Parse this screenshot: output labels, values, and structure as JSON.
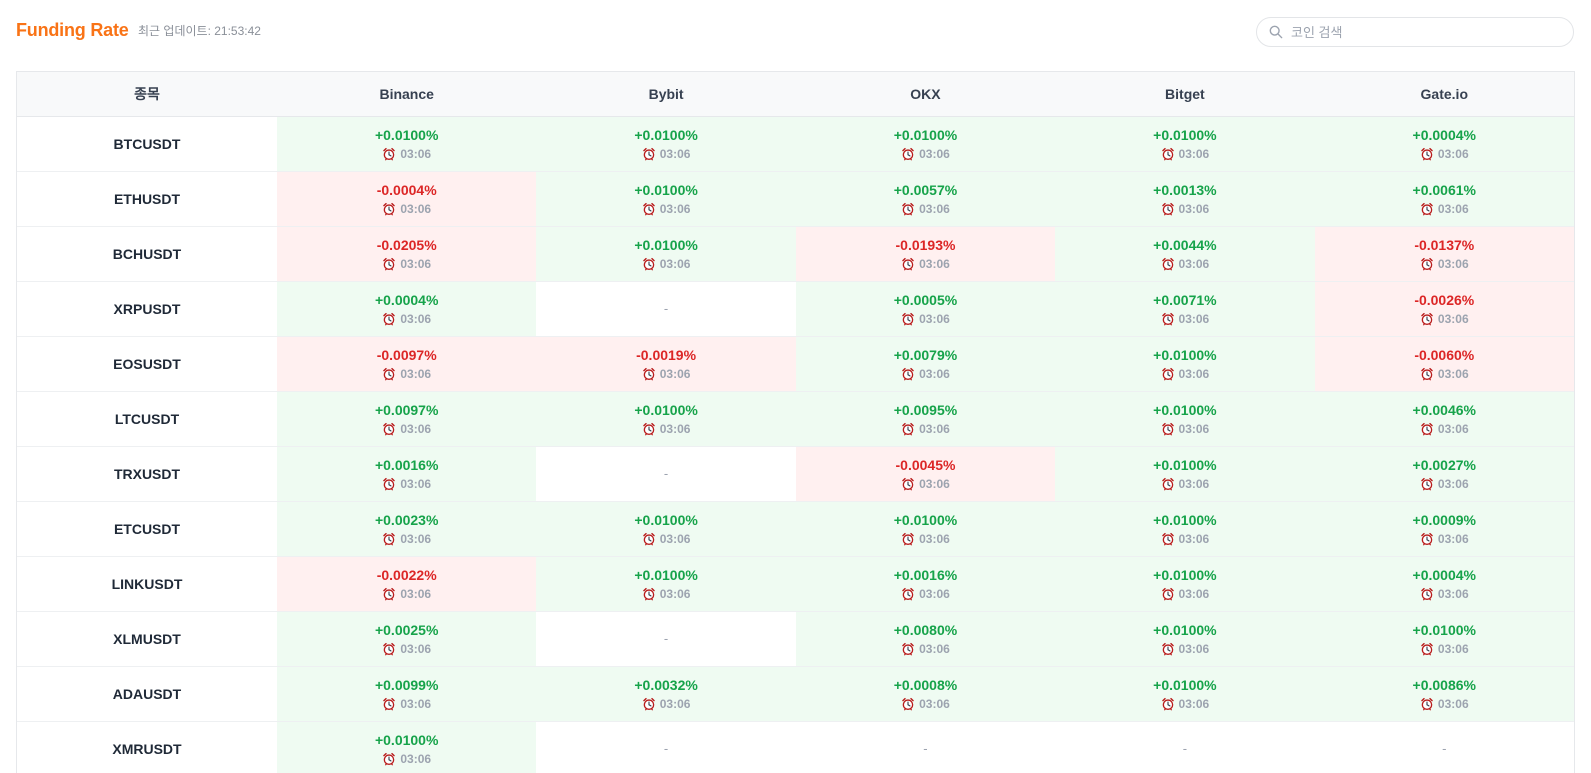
{
  "header": {
    "title": "Funding Rate",
    "updated": "최근 업데이트: 21:53:42"
  },
  "search": {
    "placeholder": "코인 검색",
    "value": ""
  },
  "table": {
    "columns": [
      "종목",
      "Binance",
      "Bybit",
      "OKX",
      "Bitget",
      "Gate.io"
    ],
    "rows": [
      {
        "symbol": "BTCUSDT",
        "cells": [
          {
            "rate": "+0.0100%",
            "time": "03:06",
            "sign": "pos"
          },
          {
            "rate": "+0.0100%",
            "time": "03:06",
            "sign": "pos"
          },
          {
            "rate": "+0.0100%",
            "time": "03:06",
            "sign": "pos"
          },
          {
            "rate": "+0.0100%",
            "time": "03:06",
            "sign": "pos"
          },
          {
            "rate": "+0.0004%",
            "time": "03:06",
            "sign": "pos"
          }
        ]
      },
      {
        "symbol": "ETHUSDT",
        "cells": [
          {
            "rate": "-0.0004%",
            "time": "03:06",
            "sign": "neg"
          },
          {
            "rate": "+0.0100%",
            "time": "03:06",
            "sign": "pos"
          },
          {
            "rate": "+0.0057%",
            "time": "03:06",
            "sign": "pos"
          },
          {
            "rate": "+0.0013%",
            "time": "03:06",
            "sign": "pos"
          },
          {
            "rate": "+0.0061%",
            "time": "03:06",
            "sign": "pos"
          }
        ]
      },
      {
        "symbol": "BCHUSDT",
        "cells": [
          {
            "rate": "-0.0205%",
            "time": "03:06",
            "sign": "neg"
          },
          {
            "rate": "+0.0100%",
            "time": "03:06",
            "sign": "pos"
          },
          {
            "rate": "-0.0193%",
            "time": "03:06",
            "sign": "neg"
          },
          {
            "rate": "+0.0044%",
            "time": "03:06",
            "sign": "pos"
          },
          {
            "rate": "-0.0137%",
            "time": "03:06",
            "sign": "neg"
          }
        ]
      },
      {
        "symbol": "XRPUSDT",
        "cells": [
          {
            "rate": "+0.0004%",
            "time": "03:06",
            "sign": "pos"
          },
          {
            "rate": "-",
            "time": "",
            "sign": "none"
          },
          {
            "rate": "+0.0005%",
            "time": "03:06",
            "sign": "pos"
          },
          {
            "rate": "+0.0071%",
            "time": "03:06",
            "sign": "pos"
          },
          {
            "rate": "-0.0026%",
            "time": "03:06",
            "sign": "neg"
          }
        ]
      },
      {
        "symbol": "EOSUSDT",
        "cells": [
          {
            "rate": "-0.0097%",
            "time": "03:06",
            "sign": "neg"
          },
          {
            "rate": "-0.0019%",
            "time": "03:06",
            "sign": "neg"
          },
          {
            "rate": "+0.0079%",
            "time": "03:06",
            "sign": "pos"
          },
          {
            "rate": "+0.0100%",
            "time": "03:06",
            "sign": "pos"
          },
          {
            "rate": "-0.0060%",
            "time": "03:06",
            "sign": "neg"
          }
        ]
      },
      {
        "symbol": "LTCUSDT",
        "cells": [
          {
            "rate": "+0.0097%",
            "time": "03:06",
            "sign": "pos"
          },
          {
            "rate": "+0.0100%",
            "time": "03:06",
            "sign": "pos"
          },
          {
            "rate": "+0.0095%",
            "time": "03:06",
            "sign": "pos"
          },
          {
            "rate": "+0.0100%",
            "time": "03:06",
            "sign": "pos"
          },
          {
            "rate": "+0.0046%",
            "time": "03:06",
            "sign": "pos"
          }
        ]
      },
      {
        "symbol": "TRXUSDT",
        "cells": [
          {
            "rate": "+0.0016%",
            "time": "03:06",
            "sign": "pos"
          },
          {
            "rate": "-",
            "time": "",
            "sign": "none"
          },
          {
            "rate": "-0.0045%",
            "time": "03:06",
            "sign": "neg"
          },
          {
            "rate": "+0.0100%",
            "time": "03:06",
            "sign": "pos"
          },
          {
            "rate": "+0.0027%",
            "time": "03:06",
            "sign": "pos"
          }
        ]
      },
      {
        "symbol": "ETCUSDT",
        "cells": [
          {
            "rate": "+0.0023%",
            "time": "03:06",
            "sign": "pos"
          },
          {
            "rate": "+0.0100%",
            "time": "03:06",
            "sign": "pos"
          },
          {
            "rate": "+0.0100%",
            "time": "03:06",
            "sign": "pos"
          },
          {
            "rate": "+0.0100%",
            "time": "03:06",
            "sign": "pos"
          },
          {
            "rate": "+0.0009%",
            "time": "03:06",
            "sign": "pos"
          }
        ]
      },
      {
        "symbol": "LINKUSDT",
        "cells": [
          {
            "rate": "-0.0022%",
            "time": "03:06",
            "sign": "neg"
          },
          {
            "rate": "+0.0100%",
            "time": "03:06",
            "sign": "pos"
          },
          {
            "rate": "+0.0016%",
            "time": "03:06",
            "sign": "pos"
          },
          {
            "rate": "+0.0100%",
            "time": "03:06",
            "sign": "pos"
          },
          {
            "rate": "+0.0004%",
            "time": "03:06",
            "sign": "pos"
          }
        ]
      },
      {
        "symbol": "XLMUSDT",
        "cells": [
          {
            "rate": "+0.0025%",
            "time": "03:06",
            "sign": "pos"
          },
          {
            "rate": "-",
            "time": "",
            "sign": "none"
          },
          {
            "rate": "+0.0080%",
            "time": "03:06",
            "sign": "pos"
          },
          {
            "rate": "+0.0100%",
            "time": "03:06",
            "sign": "pos"
          },
          {
            "rate": "+0.0100%",
            "time": "03:06",
            "sign": "pos"
          }
        ]
      },
      {
        "symbol": "ADAUSDT",
        "cells": [
          {
            "rate": "+0.0099%",
            "time": "03:06",
            "sign": "pos"
          },
          {
            "rate": "+0.0032%",
            "time": "03:06",
            "sign": "pos"
          },
          {
            "rate": "+0.0008%",
            "time": "03:06",
            "sign": "pos"
          },
          {
            "rate": "+0.0100%",
            "time": "03:06",
            "sign": "pos"
          },
          {
            "rate": "+0.0086%",
            "time": "03:06",
            "sign": "pos"
          }
        ]
      },
      {
        "symbol": "XMRUSDT",
        "cells": [
          {
            "rate": "+0.0100%",
            "time": "03:06",
            "sign": "pos"
          },
          {
            "rate": "-",
            "time": "",
            "sign": "none"
          },
          {
            "rate": "-",
            "time": "",
            "sign": "none"
          },
          {
            "rate": "-",
            "time": "",
            "sign": "none"
          },
          {
            "rate": "-",
            "time": "",
            "sign": "none"
          }
        ]
      }
    ]
  },
  "icons": {
    "search": "search-icon",
    "clock": "alarm-clock-icon"
  },
  "colors": {
    "brand": "#f97316",
    "positive_text": "#16a34a",
    "negative_text": "#dc2626",
    "positive_bg": "#effbf2",
    "negative_bg": "#fff0f0"
  }
}
